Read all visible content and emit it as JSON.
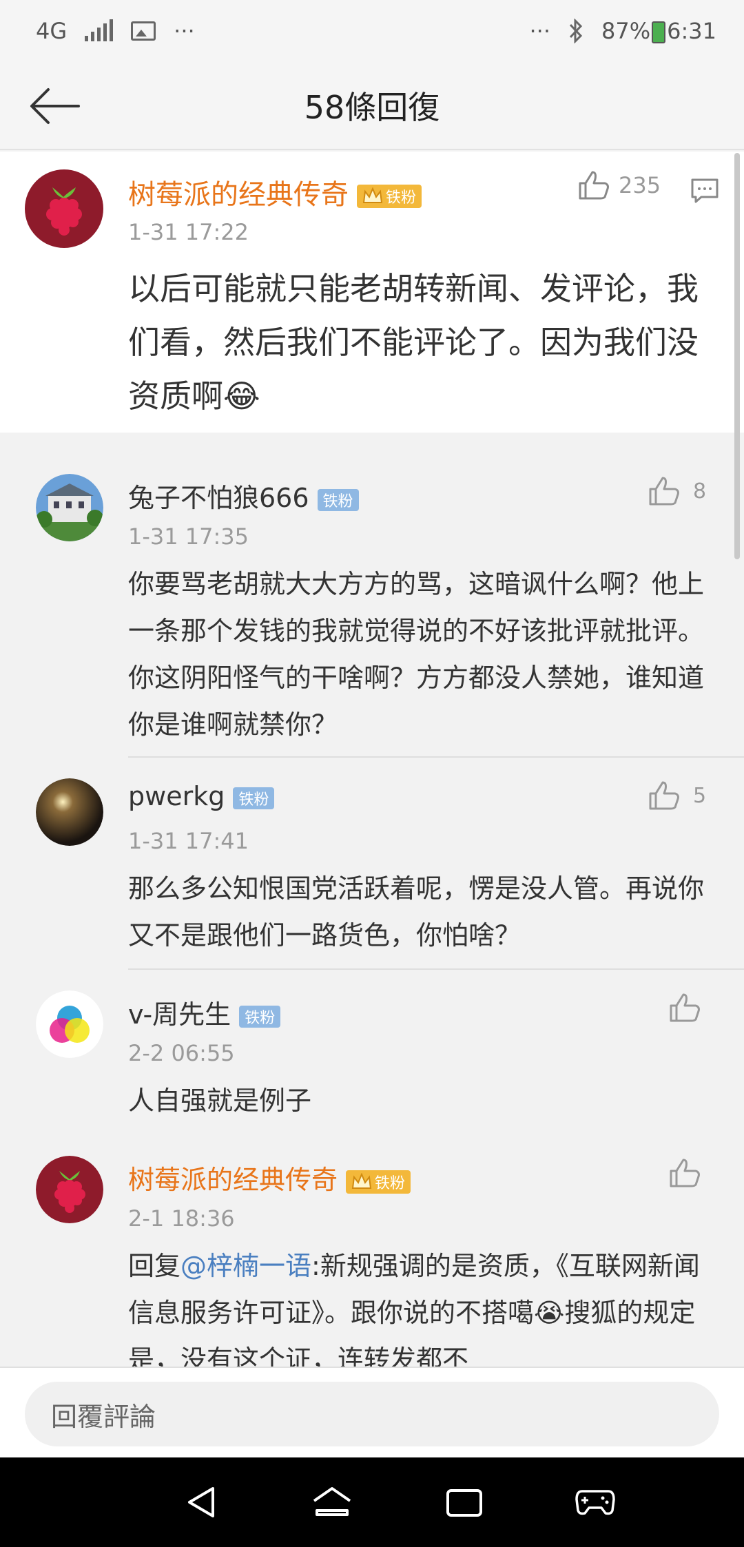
{
  "status_bar": {
    "network": "4G",
    "more": "···",
    "more_right": "···",
    "battery": "87%",
    "time": "6:31"
  },
  "header": {
    "title": "58條回復"
  },
  "main_post": {
    "name": "树莓派的经典传奇",
    "badge": "铁粉",
    "time": "1-31 17:22",
    "likes": "235",
    "content": "以后可能就只能老胡转新闻、发评论，我们看，然后我们不能评论了。因为我们没资质啊😂"
  },
  "replies": [
    {
      "name": "兔子不怕狼666",
      "badge": "铁粉",
      "time": "1-31 17:35",
      "likes": "8",
      "content": "你要骂老胡就大大方方的骂，这暗讽什么啊？他上一条那个发钱的我就觉得说的不好该批评就批评。你这阴阳怪气的干啥啊？方方都没人禁她，谁知道你是谁啊就禁你？"
    },
    {
      "name": "pwerkg",
      "badge": "铁粉",
      "time": "1-31 17:41",
      "likes": "5",
      "content": "那么多公知恨国党活跃着呢，愣是没人管。再说你又不是跟他们一路货色，你怕啥？"
    },
    {
      "name": "v-周先生",
      "badge": "铁粉",
      "time": "2-2 06:55",
      "likes": "",
      "content": "人自强就是例子"
    },
    {
      "name": "树莓派的经典传奇",
      "badge": "铁粉",
      "time": "2-1 18:36",
      "likes": "",
      "content_prefix": "回复",
      "mention": "@梓楠一语",
      "content": ":新规强调的是资质，《互联网新闻信息服务许可证》。跟你说的不搭噶😭搜狐的规定是，没有这个证，连转发都不"
    }
  ],
  "input": {
    "placeholder": "回覆評論"
  },
  "icons": {
    "back": "arrow-left-icon",
    "like": "thumbs-up-icon",
    "comment": "comment-icon",
    "bluetooth": "bluetooth-icon",
    "nav_back": "triangle-back-icon",
    "nav_home": "home-icon",
    "nav_recent": "recent-apps-icon",
    "nav_game": "gamepad-icon"
  },
  "colors": {
    "orange_name": "#e8751a",
    "mention": "#4a7fc0",
    "badge_gold": "#f3b83a",
    "badge_blue": "#8fb8e3"
  }
}
